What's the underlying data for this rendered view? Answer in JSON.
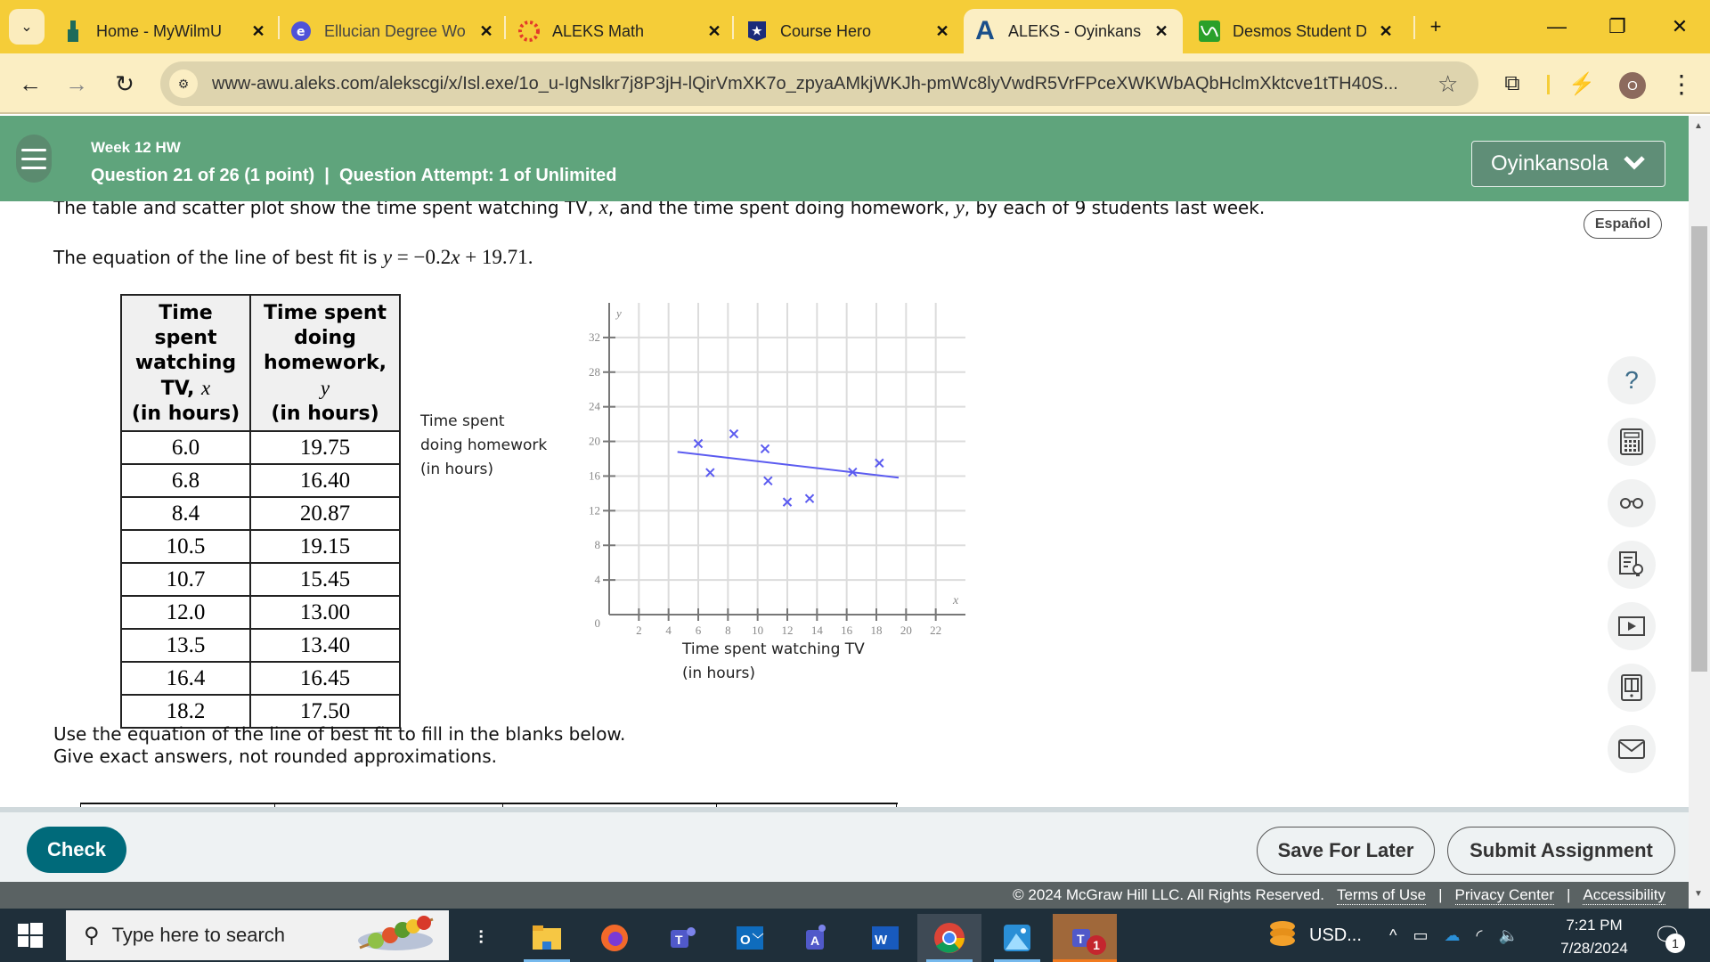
{
  "browser": {
    "tabs": [
      {
        "title": "Home - MyWilmU",
        "icon": "tower-icon",
        "active": false
      },
      {
        "title": "Ellucian Degree Works",
        "icon": "ellucian-icon",
        "active": false
      },
      {
        "title": "ALEKS Math",
        "icon": "canvas-icon",
        "active": false
      },
      {
        "title": "Course Hero",
        "icon": "coursehero-icon",
        "active": false
      },
      {
        "title": "ALEKS - Oyinkansola",
        "icon": "aleks-icon",
        "active": true
      },
      {
        "title": "Desmos Student Dashboard",
        "icon": "desmos-icon",
        "active": false
      }
    ],
    "new_tab": "+",
    "url": "www-awu.aleks.com/alekscgi/x/Isl.exe/1o_u-IgNslkr7j8P3jH-lQirVmXK7o_zpyaAMkjWKJh-pmWc8lyVwdR5VrFPceXWKWbAQbHclmXktcve1tTH40S...",
    "profile_initial": "O"
  },
  "header": {
    "assignment": "Week 12 HW",
    "question_info": "Question 21 of 26 (1 point)  |  Question Attempt: 1 of Unlimited",
    "user": "Oyinkansola",
    "language_button": "Español"
  },
  "question": {
    "intro_pre": "The table and scatter plot show the time spent watching TV, ",
    "intro_x": "x",
    "intro_mid": ", and the time spent doing homework, ",
    "intro_y": "y",
    "intro_post": ", by each of 9 students last week.",
    "eq_pre": "The equation of the line of best fit is ",
    "eq_math_y": "y",
    "eq_math_rest": " = −0.2",
    "eq_math_x": "x",
    "eq_math_tail": " + 19.71",
    "eq_post": ".",
    "table": {
      "headers": [
        {
          "line1": "Time spent",
          "line2": "watching",
          "line3a": "TV, ",
          "var": "x",
          "line4": "(in hours)"
        },
        {
          "line1": "Time spent",
          "line2": "doing",
          "line3a": "homework, ",
          "var": "y",
          "line4": "(in hours)"
        }
      ],
      "rows": [
        [
          "6.0",
          "19.75"
        ],
        [
          "6.8",
          "16.40"
        ],
        [
          "8.4",
          "20.87"
        ],
        [
          "10.5",
          "19.15"
        ],
        [
          "10.7",
          "15.45"
        ],
        [
          "12.0",
          "13.00"
        ],
        [
          "13.5",
          "13.40"
        ],
        [
          "16.4",
          "16.45"
        ],
        [
          "18.2",
          "17.50"
        ]
      ]
    },
    "y_axis_label": [
      "Time spent",
      "doing homework",
      "(in hours)"
    ],
    "x_axis_label": [
      "Time spent watching TV",
      "(in hours)"
    ],
    "instructions": [
      "Use the equation of the line of best fit to fill in the blanks below.",
      "Give exact answers, not rounded approximations."
    ]
  },
  "chart_data": {
    "type": "scatter",
    "title": "",
    "xlabel": "Time spent watching TV (in hours)",
    "ylabel": "Time spent doing homework (in hours)",
    "x_axis_var": "x",
    "y_axis_var": "y",
    "xlim": [
      0,
      24
    ],
    "ylim": [
      0,
      36
    ],
    "x_ticks": [
      2,
      4,
      6,
      8,
      10,
      12,
      14,
      16,
      18,
      20,
      22
    ],
    "y_ticks": [
      4,
      8,
      12,
      16,
      20,
      24,
      28,
      32
    ],
    "origin_label": "0",
    "grid": true,
    "marker": "x",
    "color": "#5b5bf0",
    "points": [
      {
        "x": 6.0,
        "y": 19.75
      },
      {
        "x": 6.8,
        "y": 16.4
      },
      {
        "x": 8.4,
        "y": 20.87
      },
      {
        "x": 10.5,
        "y": 19.15
      },
      {
        "x": 10.7,
        "y": 15.45
      },
      {
        "x": 12.0,
        "y": 13.0
      },
      {
        "x": 13.5,
        "y": 13.4
      },
      {
        "x": 16.4,
        "y": 16.45
      },
      {
        "x": 18.2,
        "y": 17.5
      }
    ],
    "fit_line": {
      "slope": -0.2,
      "intercept": 19.71,
      "x_range": [
        4.6,
        19.5
      ]
    }
  },
  "actions": {
    "check": "Check",
    "save": "Save For Later",
    "submit": "Submit Assignment"
  },
  "tools": [
    {
      "name": "help-icon",
      "label": "?"
    },
    {
      "name": "calculator-icon"
    },
    {
      "name": "glasses-icon"
    },
    {
      "name": "worksheet-lightbulb-icon"
    },
    {
      "name": "video-icon"
    },
    {
      "name": "ebook-icon"
    },
    {
      "name": "mail-icon"
    }
  ],
  "footer": {
    "copyright": "© 2024 McGraw Hill LLC. All Rights Reserved.",
    "links": [
      "Terms of Use",
      "Privacy Center",
      "Accessibility"
    ],
    "sep": "|"
  },
  "taskbar": {
    "search_placeholder": "Type here to search",
    "tray_currency": "USD...",
    "time": "7:21 PM",
    "date": "7/28/2024",
    "teams_badge": "1",
    "notification_badge": "1"
  }
}
